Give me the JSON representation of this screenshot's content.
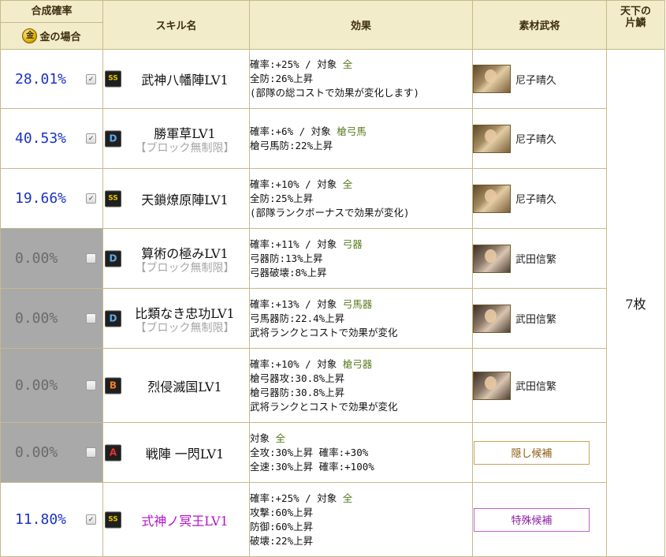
{
  "headers": {
    "rate_title": "合成確率",
    "rate_sub": "金の場合",
    "gold_icon_glyph": "金",
    "skill": "スキル名",
    "effect": "効果",
    "material": "素材武将",
    "shard": "天下の片鱗"
  },
  "shard_value": "7枚",
  "rows": [
    {
      "rate": "28.01%",
      "checked": "✓",
      "rank": "SS",
      "skill": "武神八幡陣LV1",
      "note": "",
      "effects": [
        [
          "確率:+25% / 対象 ",
          "全"
        ],
        [
          "全防:26%上昇",
          ""
        ],
        [
          "(部隊の総コストで効果が変化します)",
          ""
        ]
      ],
      "material": "尼子晴久"
    },
    {
      "rate": "40.53%",
      "checked": "✓",
      "rank": "D",
      "skill": "勝軍草LV1",
      "note": "【ブロック無制限】",
      "effects": [
        [
          "確率:+6% / 対象 ",
          "槍弓馬"
        ],
        [
          "槍弓馬防:22%上昇",
          ""
        ]
      ],
      "material": "尼子晴久"
    },
    {
      "rate": "19.66%",
      "checked": "✓",
      "rank": "SS",
      "skill": "天鎖燎原陣LV1",
      "note": "",
      "effects": [
        [
          "確率:+10% / 対象 ",
          "全"
        ],
        [
          "全防:25%上昇",
          ""
        ],
        [
          "(部隊ランクボーナスで効果が変化)",
          ""
        ]
      ],
      "material": "尼子晴久"
    },
    {
      "rate": "0.00%",
      "checked": "",
      "rank": "D",
      "skill": "算術の極みLV1",
      "note": "【ブロック無制限】",
      "effects": [
        [
          "確率:+11% / 対象 ",
          "弓器"
        ],
        [
          "弓器防:13%上昇",
          ""
        ],
        [
          "弓器破壊:8%上昇",
          ""
        ]
      ],
      "material": "武田信繁"
    },
    {
      "rate": "0.00%",
      "checked": "",
      "rank": "D",
      "skill": "比類なき忠功LV1",
      "note": "【ブロック無制限】",
      "effects": [
        [
          "確率:+13% / 対象 ",
          "弓馬器"
        ],
        [
          "弓馬器防:22.4%上昇",
          ""
        ],
        [
          "武将ランクとコストで効果が変化",
          ""
        ]
      ],
      "material": "武田信繁"
    },
    {
      "rate": "0.00%",
      "checked": "",
      "rank": "B",
      "skill": "烈侵滅国LV1",
      "note": "",
      "effects": [
        [
          "確率:+10% / 対象 ",
          "槍弓器"
        ],
        [
          "槍弓器攻:30.8%上昇",
          ""
        ],
        [
          "槍弓器防:30.8%上昇",
          ""
        ],
        [
          "武将ランクとコストで効果が変化",
          ""
        ]
      ],
      "material": "武田信繁"
    },
    {
      "rate": "0.00%",
      "checked": "",
      "rank": "A",
      "skill": "戦陣 一閃LV1",
      "note": "",
      "effects": [
        [
          "対象 ",
          "全"
        ],
        [
          "全攻:30%上昇 確率:+30%",
          ""
        ],
        [
          "全速:30%上昇 確率:+100%",
          ""
        ]
      ],
      "material_button": "隠し候補"
    },
    {
      "rate": "11.80%",
      "checked": "✓",
      "rank": "SS",
      "skill": "式神ノ冥王LV1",
      "note": "",
      "effects": [
        [
          "確率:+25% / 対象 ",
          "全"
        ],
        [
          "攻撃:60%上昇",
          ""
        ],
        [
          "防御:60%上昇",
          ""
        ],
        [
          "破壊:22%上昇",
          ""
        ]
      ],
      "material_button": "特殊候補"
    }
  ]
}
